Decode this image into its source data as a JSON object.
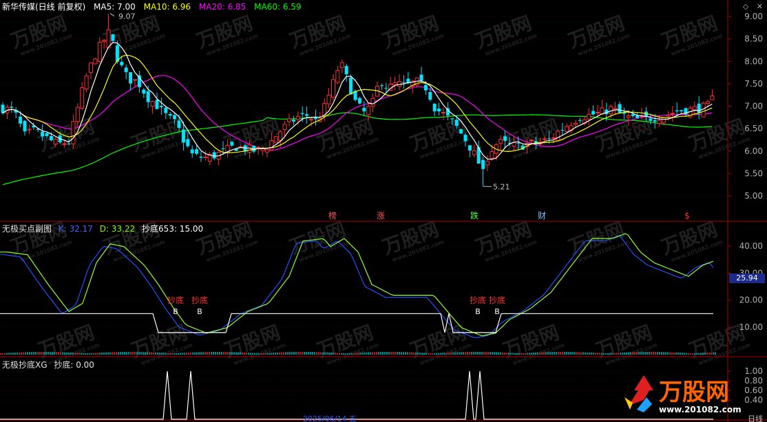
{
  "header": {
    "stock_name": "新华传媒(日线 前复权)",
    "ma5_label": "MA5: 7.00",
    "ma10_label": "MA10: 6.96",
    "ma20_label": "MA20: 6.85",
    "ma60_label": "MA60: 6.59",
    "colors": {
      "ma5": "#ffffff",
      "ma10": "#ffff00",
      "ma20": "#ff00ff",
      "ma60": "#00ff00"
    }
  },
  "window_controls": {
    "diamond": "◇",
    "close": "✕"
  },
  "main_panel": {
    "y_ticks": [
      "9.00",
      "8.50",
      "8.00",
      "7.50",
      "7.00",
      "6.50",
      "6.00",
      "5.50",
      "5.00"
    ],
    "high_label": "9.07",
    "low_label": "5.21",
    "event_marks": [
      {
        "text": "榜",
        "color": "#ff5050"
      },
      {
        "text": "涨",
        "color": "#ff5050"
      },
      {
        "text": "跌",
        "color": "#50ff50"
      },
      {
        "text": "财",
        "color": "#80c0ff"
      },
      {
        "text": "$",
        "color": "#ff3030"
      }
    ]
  },
  "indicator1": {
    "name": "无极买点副图",
    "k_label": "K: 32.17",
    "d_label": "D: 33.22",
    "cd_label": "抄底653: 15.00",
    "current_value": "25.94",
    "y_ticks": [
      "40.00",
      "30.00",
      "20.00",
      "10.00"
    ],
    "signal_text": "抄底",
    "signal_b": "B",
    "signal_count": 4
  },
  "indicator2": {
    "name": "无极抄底XG",
    "value_label": "抄底: 0.00",
    "y_ticks": [
      "1.00",
      "0.80",
      "0.60",
      "0.40"
    ]
  },
  "bottom": {
    "date_label": "2025/06/14 五",
    "right_label": "日线"
  },
  "watermark": {
    "text": "万股网",
    "url": "www.201082.com"
  },
  "chart_data": [
    {
      "type": "candlestick",
      "title": "新华传媒(日线 前复权)",
      "ylim": [
        4.8,
        9.4
      ],
      "series": [
        {
          "name": "MA5",
          "value": 7.0
        },
        {
          "name": "MA10",
          "value": 6.96
        },
        {
          "name": "MA20",
          "value": 6.85
        },
        {
          "name": "MA60",
          "value": 6.59
        }
      ],
      "high": 9.07,
      "low": 5.21
    },
    {
      "type": "line",
      "title": "无极买点副图",
      "ylim": [
        0,
        48
      ],
      "series": [
        {
          "name": "K",
          "last": 32.17
        },
        {
          "name": "D",
          "last": 33.22
        },
        {
          "name": "抄底653",
          "last": 15.0
        }
      ]
    },
    {
      "type": "line",
      "title": "无极抄底XG",
      "ylim": [
        0,
        1.1
      ],
      "series": [
        {
          "name": "抄底",
          "last": 0.0
        }
      ]
    }
  ]
}
